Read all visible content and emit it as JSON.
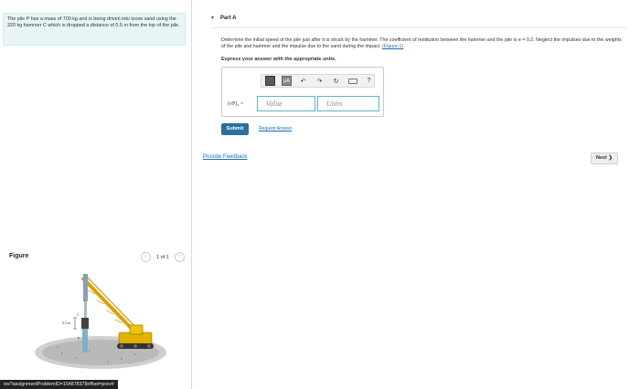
{
  "problem": {
    "text": "The pile P has a mass of 700 kg and is being driven into loose sand using the 320 kg hammer C which is dropped a distance of 0.5 m from the top of the pile."
  },
  "figure": {
    "label": "Figure",
    "pager": "1 of 1",
    "prev_icon": "chevron-left-icon",
    "next_icon": "chevron-right-icon",
    "dimension_label": "0.5 m",
    "label_c": "C",
    "label_p": "P"
  },
  "status_url": "ew?assignmentProblemID=154878378offset=prev#",
  "part": {
    "title": "Part A",
    "question": "Determine the initial speed of the pile just after it is struck by the hammer. The coefficient of restitution between the hammer and the pile is e = 0.2. Neglect the impulses due to the weights of the pile and hammer and the impulse due to the sand during the impact.",
    "figure_link": "(Figure 1)",
    "instruction": "Express your answer with the appropriate units."
  },
  "toolbar": {
    "icons": [
      "templates-icon",
      "mu-units-icon",
      "undo-icon",
      "redo-icon",
      "reset-icon",
      "keyboard-icon",
      "help-icon"
    ],
    "mu_label": "μA",
    "help_label": "?"
  },
  "answer": {
    "label": "(vP)₂ =",
    "value_placeholder": "Value",
    "units_placeholder": "Units"
  },
  "buttons": {
    "submit": "Submit",
    "request_answer": "Request Answer",
    "feedback": "Provide Feedback",
    "next": "Next ❯"
  },
  "colors": {
    "accent": "#2b6f9c",
    "link": "#1a6fb0",
    "problem_bg": "#e7f5f7",
    "input_border": "#5bb5c6"
  }
}
